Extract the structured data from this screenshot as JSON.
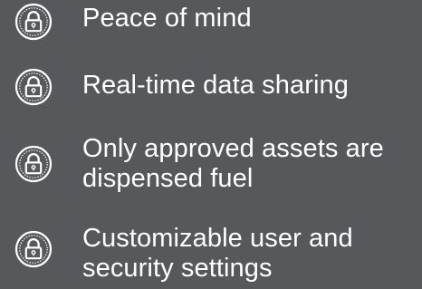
{
  "colors": {
    "background": "#56585b",
    "text": "#ffffff",
    "icon": "#ffffff"
  },
  "features": {
    "items": [
      {
        "icon": "lock-badge-icon",
        "label": "Peace of mind"
      },
      {
        "icon": "lock-badge-icon",
        "label": "Real-time data sharing"
      },
      {
        "icon": "lock-badge-icon",
        "label": "Only approved assets are dispensed fuel"
      },
      {
        "icon": "lock-badge-icon",
        "label": "Customizable user and security settings"
      }
    ]
  }
}
